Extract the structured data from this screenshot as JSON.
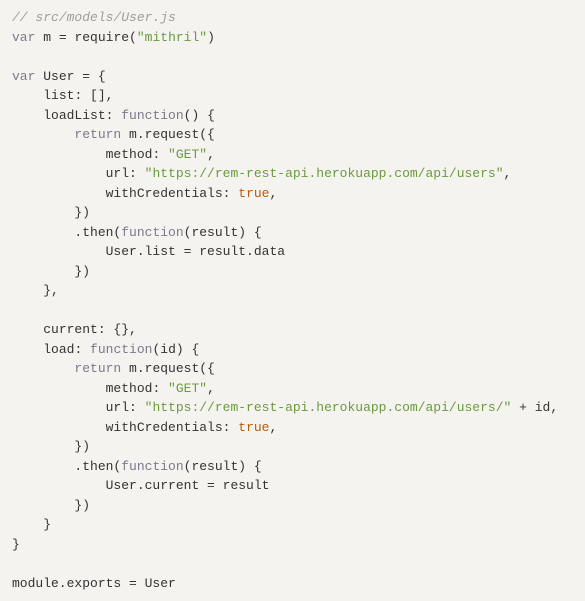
{
  "code": {
    "comment": "// src/models/User.js",
    "kw_var1": "var",
    "m_ident": "m",
    "eq1": " = ",
    "require_fn": "require",
    "lparen1": "(",
    "mithril_str": "\"mithril\"",
    "rparen1": ")",
    "kw_var2": "var",
    "user_ident": "User",
    "eq2": " = {",
    "list_key": "list",
    "list_val": ": [],",
    "loadList_key": "loadList",
    "loadList_colon": ": ",
    "kw_function1": "function",
    "loadList_parens": "() {",
    "return1": "return",
    "m_request1": " m.request({",
    "method_key1": "method",
    "method_colon1": ": ",
    "method_val1": "\"GET\"",
    "comma1": ",",
    "url_key1": "url",
    "url_colon1": ": ",
    "url_val1": "\"https://rem-rest-api.herokuapp.com/api/users\"",
    "comma2": ",",
    "withCred_key1": "withCredentials",
    "withCred_colon1": ": ",
    "true1": "true",
    "comma3": ",",
    "close_obj1": "})",
    "then1": ".then(",
    "kw_function2": "function",
    "then1_parens": "(result) {",
    "userlist_assign": "User.list = result.data",
    "close_then1": "})",
    "close_loadList": "},",
    "current_key": "current",
    "current_val": ": {},",
    "load_key": "load",
    "load_colon": ": ",
    "kw_function3": "function",
    "load_parens": "(id) {",
    "return2": "return",
    "m_request2": " m.request({",
    "method_key2": "method",
    "method_colon2": ": ",
    "method_val2": "\"GET\"",
    "comma4": ",",
    "url_key2": "url",
    "url_colon2": ": ",
    "url_val2": "\"https://rem-rest-api.herokuapp.com/api/users/\"",
    "plus_id": " + id,",
    "withCred_key2": "withCredentials",
    "withCred_colon2": ": ",
    "true2": "true",
    "comma5": ",",
    "close_obj2": "})",
    "then2": ".then(",
    "kw_function4": "function",
    "then2_parens": "(result) {",
    "usercurrent_assign": "User.current = result",
    "close_then2": "})",
    "close_load": "}",
    "close_user": "}",
    "module_exports": "module.exports = User"
  }
}
